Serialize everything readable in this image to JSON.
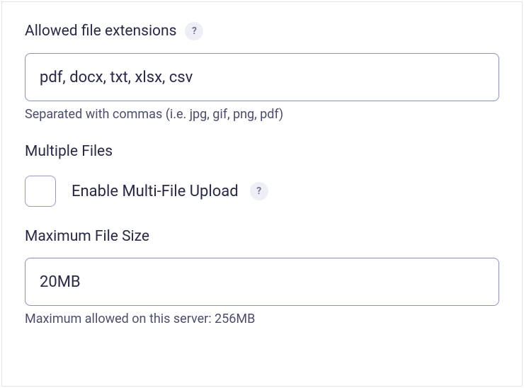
{
  "allowed_extensions": {
    "label": "Allowed file extensions",
    "value": "pdf, docx, txt, xlsx, csv",
    "helper": "Separated with commas (i.e. jpg, gif, png, pdf)",
    "help_glyph": "?"
  },
  "multiple_files": {
    "heading": "Multiple Files",
    "checkbox_label": "Enable Multi-File Upload",
    "help_glyph": "?"
  },
  "max_file_size": {
    "label": "Maximum File Size",
    "value": "20MB",
    "helper": "Maximum allowed on this server: 256MB"
  }
}
